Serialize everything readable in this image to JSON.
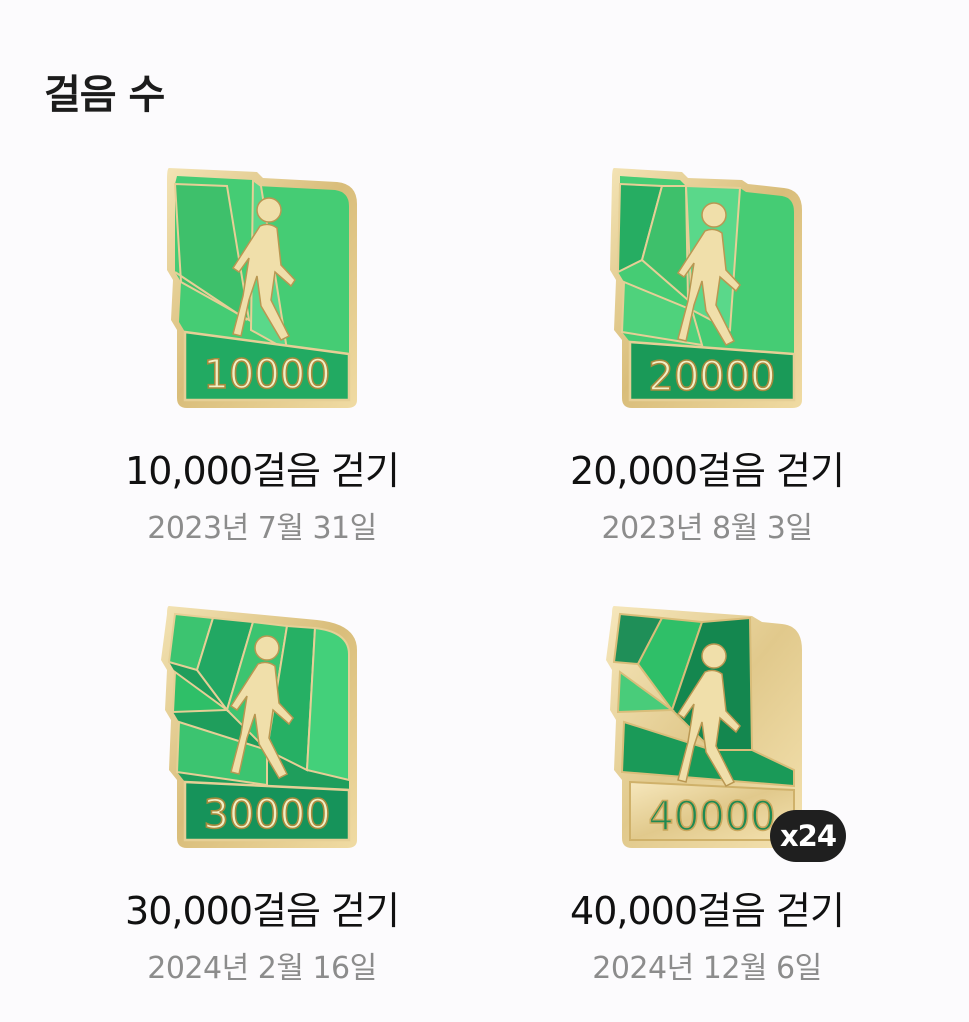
{
  "section": {
    "title": "걸음 수"
  },
  "badges": [
    {
      "number": "10000",
      "title": "10,000걸음 걷기",
      "date": "2023년 7월 31일",
      "count": ""
    },
    {
      "number": "20000",
      "title": "20,000걸음 걷기",
      "date": "2023년 8월 3일",
      "count": ""
    },
    {
      "number": "30000",
      "title": "30,000걸음 걷기",
      "date": "2024년 2월 16일",
      "count": ""
    },
    {
      "number": "40000",
      "title": "40,000걸음 걷기",
      "date": "2024년 12월 6일",
      "count": "x24"
    }
  ],
  "colors": {
    "gold_frame": "#e6cf96",
    "green_light": "#4fd27c",
    "green_mid": "#2fbf68",
    "green_dark": "#16935a",
    "count_badge_bg": "#1f1f1f"
  },
  "icons": {
    "badge_figure": "walking-person-icon"
  }
}
